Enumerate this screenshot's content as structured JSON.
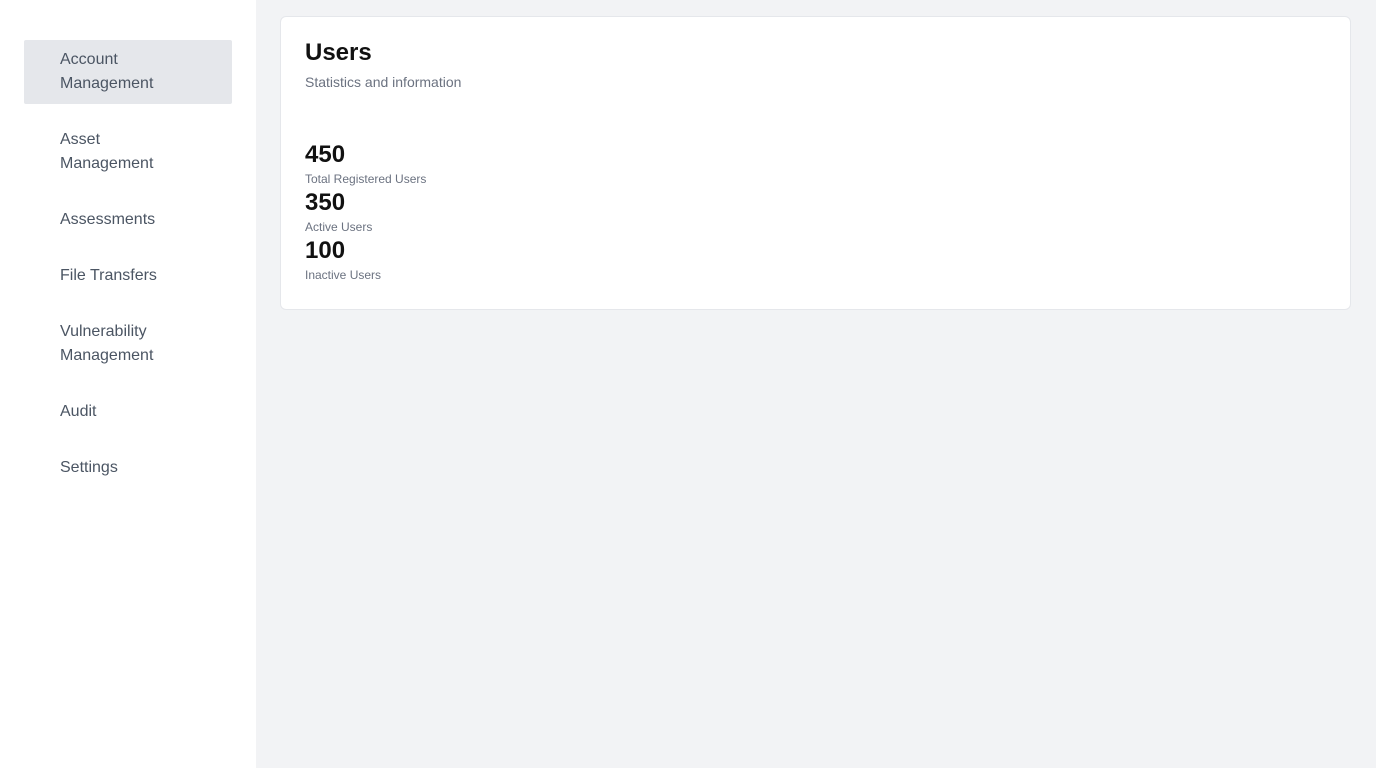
{
  "sidebar": {
    "items": [
      {
        "label": "Account Management",
        "active": true
      },
      {
        "label": "Asset Management",
        "active": false
      },
      {
        "label": "Assessments",
        "active": false
      },
      {
        "label": "File Transfers",
        "active": false
      },
      {
        "label": "Vulnerability Management",
        "active": false
      },
      {
        "label": "Audit",
        "active": false
      },
      {
        "label": "Settings",
        "active": false
      }
    ]
  },
  "users_card": {
    "title": "Users",
    "subtitle": "Statistics and information",
    "stats": [
      {
        "value": "450",
        "label": "Total Registered Users"
      },
      {
        "value": "350",
        "label": "Active Users"
      },
      {
        "value": "100",
        "label": "Inactive Users"
      }
    ]
  },
  "colors": {
    "background": "#f2f3f5",
    "sidebar_bg": "#ffffff",
    "active_item_bg": "#e5e7eb",
    "text_primary": "#111111",
    "text_muted": "#6b7280"
  }
}
